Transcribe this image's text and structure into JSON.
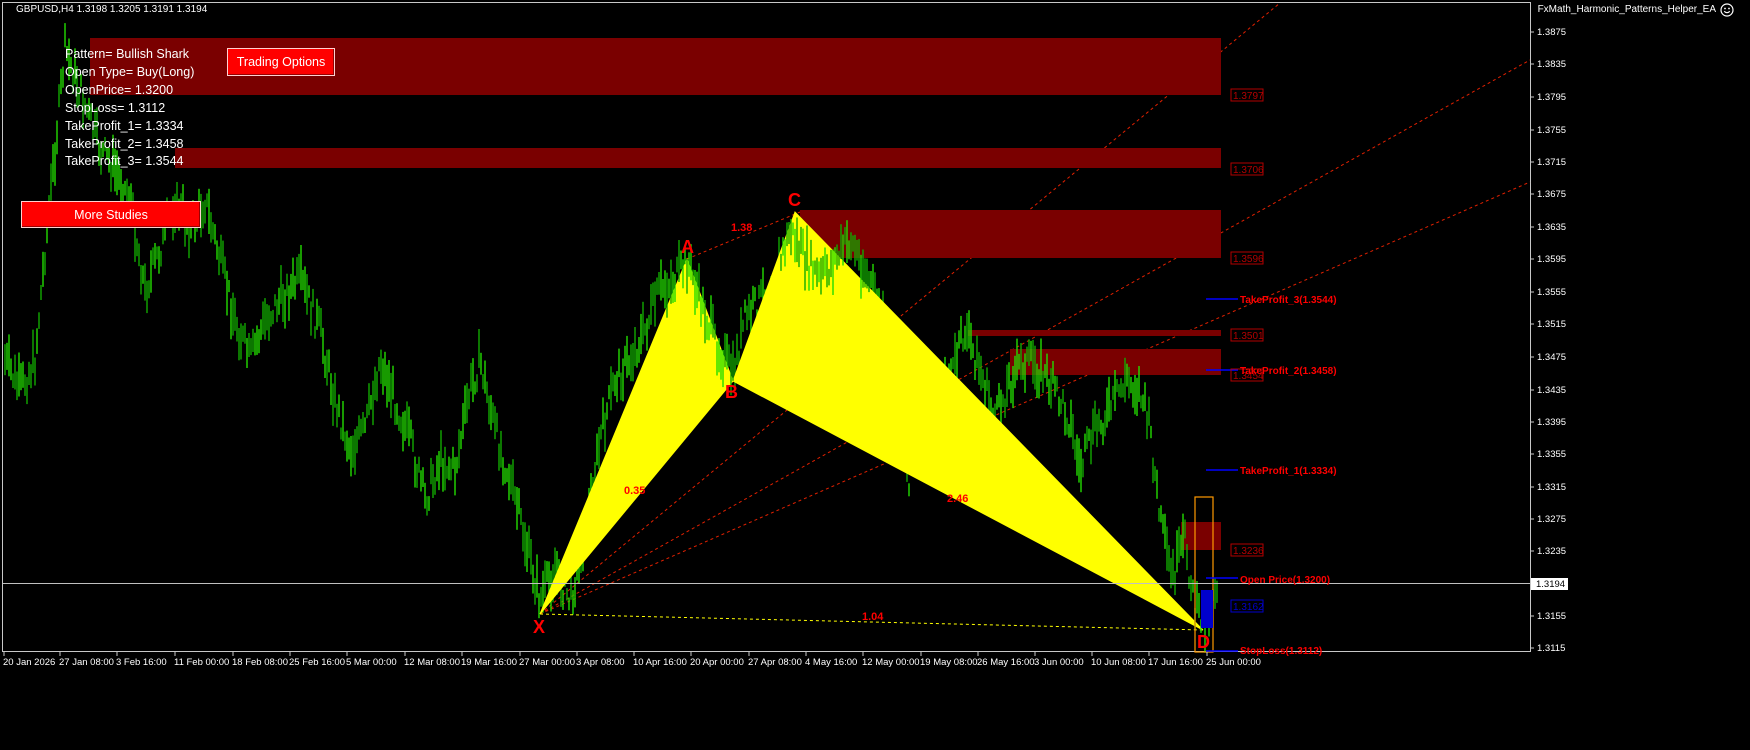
{
  "header": {
    "symbol_info": "GBPUSD,H4  1.3198 1.3205 1.3191 1.3194",
    "ea_name": "FxMath_Harmonic_Patterns_Helper_EA"
  },
  "info_panel": {
    "lines": [
      "Pattern= Bullish Shark",
      "Open Type= Buy(Long)",
      "OpenPrice= 1.3200",
      "StopLoss= 1.3112",
      "TakeProfit_1= 1.3334",
      "TakeProfit_2= 1.3458",
      "TakeProfit_3= 1.3544"
    ]
  },
  "buttons": {
    "trading_options": "Trading Options",
    "more_studies": "More Studies"
  },
  "icons": {
    "smiley": "smiley-face-icon"
  },
  "colors": {
    "candles": "#22dd00",
    "pattern_fill": "#ffff00",
    "zones": "#7a0000",
    "labels": "#ff0000",
    "tp_lines": "#0000ff",
    "trend_lines": "#ff2200"
  },
  "chart_data": {
    "type": "candlestick",
    "price_axis_ticks": [
      "1.3875",
      "1.3835",
      "1.3795",
      "1.3755",
      "1.3715",
      "1.3675",
      "1.3635",
      "1.3595",
      "1.3555",
      "1.3515",
      "1.3475",
      "1.3435",
      "1.3395",
      "1.3355",
      "1.3315",
      "1.3275",
      "1.3235",
      "1.3155",
      "1.3115"
    ],
    "current_price": "1.3194",
    "time_axis_ticks": [
      "20 Jan 2026",
      "27 Jan 08:00",
      "3 Feb 16:00",
      "11 Feb 00:00",
      "18 Feb 08:00",
      "25 Feb 16:00",
      "5 Mar 00:00",
      "12 Mar 08:00",
      "19 Mar 16:00",
      "27 Mar 00:00",
      "3 Apr 08:00",
      "10 Apr 16:00",
      "20 Apr 00:00",
      "27 Apr 08:00",
      "4 May 16:00",
      "12 May 00:00",
      "19 May 08:00",
      "26 May 16:00",
      "3 Jun 00:00",
      "10 Jun 08:00",
      "17 Jun 16:00",
      "25 Jun 00:00"
    ],
    "pattern_points": {
      "X": {
        "label": "X",
        "price": 1.3159
      },
      "A": {
        "label": "A",
        "price": 1.3594
      },
      "B": {
        "label": "B",
        "price": 1.344
      },
      "C": {
        "label": "C",
        "price": 1.365
      },
      "D": {
        "label": "D",
        "price": 1.3139
      }
    },
    "ratios": [
      "1.38",
      "0.35",
      "2.46",
      "1.04"
    ],
    "zone_labels": [
      "1.3797",
      "1.3706",
      "1.3596",
      "1.3501",
      "1.3454",
      "1.3236",
      "1.3162"
    ],
    "levels": [
      {
        "name": "TakeProfit_3(1.3544)",
        "price": 1.3544
      },
      {
        "name": "TakeProfit_2(1.3458)",
        "price": 1.3458
      },
      {
        "name": "TakeProfit_1(1.3334)",
        "price": 1.3334
      },
      {
        "name": "Open Price(1.3200)",
        "price": 1.32
      },
      {
        "name": "StopLoss(1.3112)",
        "price": 1.3112
      }
    ]
  }
}
